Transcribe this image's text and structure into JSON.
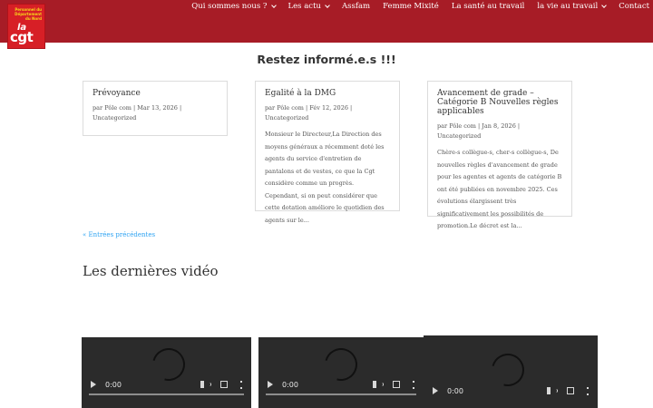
{
  "logo": {
    "org_text": "Personnel du Département du Nord",
    "la": "la",
    "brand": "cgt"
  },
  "nav": {
    "items": [
      {
        "label": "Qui sommes nous ?",
        "dropdown": true
      },
      {
        "label": "Les actu",
        "dropdown": true
      },
      {
        "label": "Assfam",
        "dropdown": false
      },
      {
        "label": "Femme Mixité",
        "dropdown": false
      },
      {
        "label": "La santé au travail",
        "dropdown": false
      },
      {
        "label": "la vie au travail",
        "dropdown": true
      },
      {
        "label": "Contact",
        "dropdown": false
      }
    ]
  },
  "section": {
    "title": "Restez informé.e.s !!!"
  },
  "posts": [
    {
      "title": "Prévoyance",
      "author": "Pôle com",
      "date": "Mar 13, 2026",
      "category": "Uncategorized",
      "excerpt": ""
    },
    {
      "title": "Egalité à la DMG",
      "author": "Pôle com",
      "date": "Fév 12, 2026",
      "category": "Uncategorized",
      "excerpt": "Monsieur le Directeur,La Direction des moyens généraux a récemment doté les agents du service d'entretien de pantalons et de vestes, ce que la Cgt considère comme un progrès. Cependant, si on peut considérer que cette dotation améliore le quotidien des agents sur le..."
    },
    {
      "title": "Avancement de grade – Catégorie B Nouvelles règles applicables",
      "author": "Pôle com",
      "date": "Jan 8, 2026",
      "category": "Uncategorized",
      "excerpt": "Chère-s collègue-s, cher-s collègue-s, De nouvelles règles d'avancement de grade pour les agentes et agents de catégorie B ont été publiées en novembre 2025. Ces évolutions élargissent très significativement les possibilités de promotion.Le décret est la..."
    }
  ],
  "pagination": {
    "prev_label": "« Entrées précédentes"
  },
  "videos": {
    "title": "Les dernières vidéo",
    "items": [
      {
        "time": "0:00"
      },
      {
        "time": "0:00"
      },
      {
        "time": "0:00"
      }
    ]
  },
  "colors": {
    "header": "#a71c26",
    "link": "#2ea3f2",
    "logo": "#d71f26"
  }
}
